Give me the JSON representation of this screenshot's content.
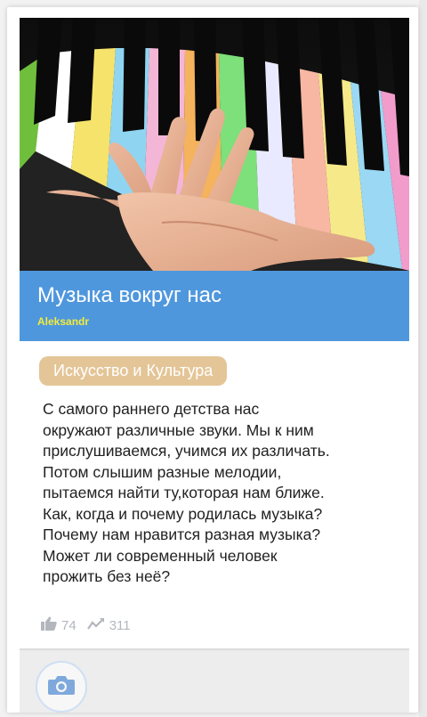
{
  "post": {
    "title": "Музыка вокруг нас",
    "author": "Aleksandr",
    "category": "Искусство и Культура",
    "description_lines": [
      "С самого раннего детства нас",
      "окружают различные звуки. Мы к ним",
      "прислушиваемся, учимся их различать.",
      "Потом слышим разные мелодии,",
      "пытаемся найти ту,которая нам ближе.",
      "Как, когда и почему родилась музыка?",
      "Почему нам нравится разная музыка?",
      "Может ли современный человек",
      "прожить без неё?"
    ],
    "likes": "74",
    "views": "311"
  },
  "icons": {
    "likes": "thumbs-up-icon",
    "views": "trend-icon",
    "camera": "camera-icon"
  },
  "colors": {
    "banner": "#4f97dd",
    "author": "#f3ec3a",
    "category_chip": "#e4c597",
    "stats": "#b3b7bd"
  }
}
